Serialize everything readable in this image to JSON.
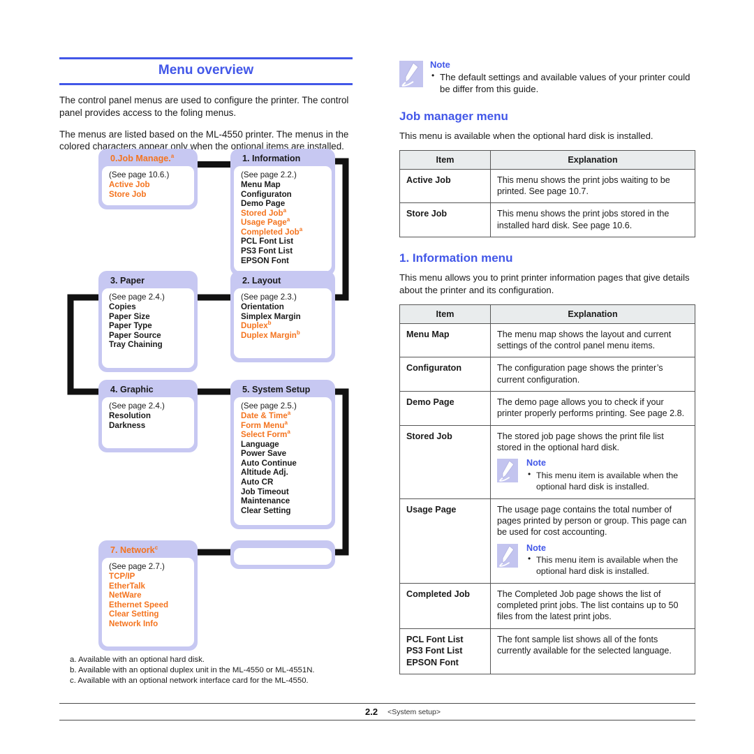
{
  "document": {
    "chapter_title": "Menu overview",
    "intro_paragraphs": [
      "The control panel menus are used to configure the printer. The control panel provides access to the foling menus.",
      "The menus are listed based on the ML-4550 printer. The menus in the colored characters appear only when the optional items are installed."
    ],
    "footnotes": [
      "a. Available with an optional hard disk.",
      "b. Available with an optional duplex unit in the ML-4550 or ML-4551N.",
      "c. Available with an optional network interface card for the ML-4550."
    ],
    "footer": {
      "page_number": "2.2",
      "section": "<System setup>"
    }
  },
  "colors": {
    "accent_blue": "#4257e8",
    "optional_orange": "#f4741f",
    "node_fill": "#c7c8f2",
    "table_header": "#e9eced"
  },
  "flow_diagram": {
    "nodes": [
      {
        "id": "job-manage",
        "title": "0.Job Manage.",
        "title_footnote": "a",
        "title_color": "orange",
        "see": "(See page 10.6.)",
        "items": [
          {
            "label": "Active Job",
            "color": "orange",
            "footnote": ""
          },
          {
            "label": "Store Job",
            "color": "orange",
            "footnote": ""
          }
        ]
      },
      {
        "id": "information",
        "title": "1. Information",
        "title_footnote": "",
        "title_color": "black",
        "see": "(See page 2.2.)",
        "items": [
          {
            "label": "Menu Map",
            "color": "black",
            "footnote": ""
          },
          {
            "label": "Configuraton",
            "color": "black",
            "footnote": ""
          },
          {
            "label": "Demo Page",
            "color": "black",
            "footnote": ""
          },
          {
            "label": "Stored Job",
            "color": "orange",
            "footnote": "a"
          },
          {
            "label": "Usage Page",
            "color": "orange",
            "footnote": "a"
          },
          {
            "label": "Completed Job",
            "color": "orange",
            "footnote": "a"
          },
          {
            "label": "PCL Font List",
            "color": "black",
            "footnote": ""
          },
          {
            "label": "PS3 Font List",
            "color": "black",
            "footnote": ""
          },
          {
            "label": "EPSON Font",
            "color": "black",
            "footnote": ""
          }
        ]
      },
      {
        "id": "paper",
        "title": "3. Paper",
        "title_footnote": "",
        "title_color": "black",
        "see": "(See page 2.4.)",
        "items": [
          {
            "label": "Copies",
            "color": "black",
            "footnote": ""
          },
          {
            "label": "Paper Size",
            "color": "black",
            "footnote": ""
          },
          {
            "label": "Paper Type",
            "color": "black",
            "footnote": ""
          },
          {
            "label": "Paper Source",
            "color": "black",
            "footnote": ""
          },
          {
            "label": "Tray Chaining",
            "color": "black",
            "footnote": ""
          }
        ]
      },
      {
        "id": "layout",
        "title": "2. Layout",
        "title_footnote": "",
        "title_color": "black",
        "see": "(See page 2.3.)",
        "items": [
          {
            "label": "Orientation",
            "color": "black",
            "footnote": ""
          },
          {
            "label": "Simplex Margin",
            "color": "black",
            "footnote": ""
          },
          {
            "label": "Duplex",
            "color": "orange",
            "footnote": "b"
          },
          {
            "label": "Duplex Margin",
            "color": "orange",
            "footnote": "b"
          }
        ]
      },
      {
        "id": "graphic",
        "title": "4. Graphic",
        "title_footnote": "",
        "title_color": "black",
        "see": "(See page 2.4.)",
        "items": [
          {
            "label": "Resolution",
            "color": "black",
            "footnote": ""
          },
          {
            "label": "Darkness",
            "color": "black",
            "footnote": ""
          }
        ]
      },
      {
        "id": "system-setup",
        "title": "5. System Setup",
        "title_footnote": "",
        "title_color": "black",
        "see": "(See page 2.5.)",
        "items": [
          {
            "label": "Date & Time",
            "color": "orange",
            "footnote": "a"
          },
          {
            "label": "Form Menu",
            "color": "orange",
            "footnote": "a"
          },
          {
            "label": "Select Form",
            "color": "orange",
            "footnote": "a"
          },
          {
            "label": "Language",
            "color": "black",
            "footnote": ""
          },
          {
            "label": "Power Save",
            "color": "black",
            "footnote": ""
          },
          {
            "label": "Auto Continue",
            "color": "black",
            "footnote": ""
          },
          {
            "label": "Altitude Adj.",
            "color": "black",
            "footnote": ""
          },
          {
            "label": "Auto CR",
            "color": "black",
            "footnote": ""
          },
          {
            "label": "Job Timeout",
            "color": "black",
            "footnote": ""
          },
          {
            "label": "Maintenance",
            "color": "black",
            "footnote": ""
          },
          {
            "label": "Clear Setting",
            "color": "black",
            "footnote": ""
          }
        ]
      },
      {
        "id": "network",
        "title": "7. Network",
        "title_footnote": "c",
        "title_color": "orange",
        "see": "(See page 2.7.)",
        "items": [
          {
            "label": "TCP/IP",
            "color": "orange",
            "footnote": ""
          },
          {
            "label": "EtherTalk",
            "color": "orange",
            "footnote": ""
          },
          {
            "label": "NetWare",
            "color": "orange",
            "footnote": ""
          },
          {
            "label": "Ethernet Speed",
            "color": "orange",
            "footnote": ""
          },
          {
            "label": "Clear Setting",
            "color": "orange",
            "footnote": ""
          },
          {
            "label": "Network Info",
            "color": "orange",
            "footnote": ""
          }
        ]
      }
    ]
  },
  "note_top": {
    "title": "Note",
    "bullet": "The default settings and available values of your printer could be differ from this guide."
  },
  "job_manager_section": {
    "title": "Job manager menu",
    "intro": "This menu is available when the optional hard disk is installed.",
    "table": {
      "headers": [
        "Item",
        "Explanation"
      ],
      "rows": [
        {
          "item": "Active Job",
          "explanation": "This menu shows the print jobs waiting to be printed. See page 10.7."
        },
        {
          "item": "Store Job",
          "explanation": "This menu shows the print jobs stored in the installed hard disk. See page 10.6."
        }
      ]
    }
  },
  "information_section": {
    "title": "1. Information menu",
    "intro": "This menu allows you to print printer information pages that give details about the printer and its configuration.",
    "table": {
      "headers": [
        "Item",
        "Explanation"
      ],
      "rows": [
        {
          "item": "Menu Map",
          "explanation": "The menu map shows the layout and current settings of the control panel menu items."
        },
        {
          "item": "Configuraton",
          "explanation": "The configuration page shows the printer’s current configuration."
        },
        {
          "item": "Demo Page",
          "explanation": "The demo page allows you to check if your printer properly performs printing. See page 2.8."
        },
        {
          "item": "Stored Job",
          "explanation": "The stored job page shows the print file list stored in the optional hard disk.",
          "note": {
            "title": "Note",
            "bullet": "This menu item is available when the optional hard disk is installed."
          }
        },
        {
          "item": "Usage Page",
          "explanation": "The usage page contains the total number of pages printed by person or group. This page can be used for cost accounting.",
          "note": {
            "title": "Note",
            "bullet": "This menu item is available when the optional hard disk is installed."
          }
        },
        {
          "item": "Completed Job",
          "explanation": "The Completed Job page shows the list of completed print jobs. The list contains up to 50 files from the latest print jobs."
        },
        {
          "item_lines": [
            "PCL Font List",
            "PS3 Font List",
            "EPSON Font"
          ],
          "explanation": "The font sample list shows all of the fonts currently available for the selected language."
        }
      ]
    }
  }
}
